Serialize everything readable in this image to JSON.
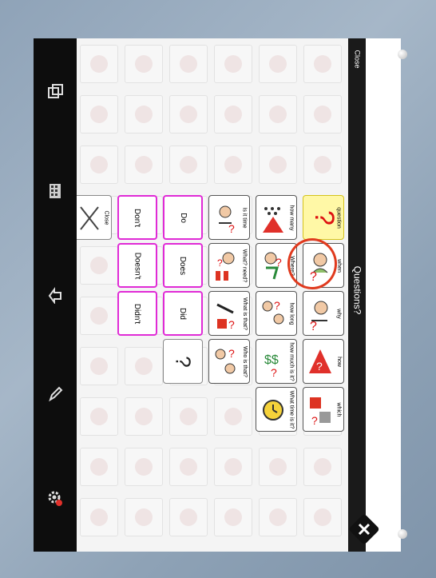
{
  "dialog": {
    "title": "Questions?",
    "close_label": "Close"
  },
  "grid": {
    "col_question": [
      {
        "label": "question",
        "symbol": "big-question-mark"
      },
      {
        "label": "when",
        "symbol": "person-thinking-question"
      },
      {
        "label": "why",
        "symbol": "person-pointing-question"
      },
      {
        "label": "how",
        "symbol": "red-triangle-question"
      },
      {
        "label": "which",
        "symbol": "boxes-question"
      }
    ],
    "col_how": [
      {
        "label": "how many",
        "symbol": "dots-question"
      },
      {
        "label": "Where?",
        "symbol": "person-walking-question"
      },
      {
        "label": "how long",
        "symbol": "people-talking-question"
      },
      {
        "label": "how much is it?",
        "symbol": "money-question"
      },
      {
        "label": "What time is it?",
        "symbol": "clock-question"
      }
    ],
    "col_is": [
      {
        "label": "Is it time",
        "symbol": "person-question"
      },
      {
        "label": "What? need?",
        "symbol": "person-items-question"
      },
      {
        "label": "What is that?",
        "symbol": "person-pointing-object"
      },
      {
        "label": "Who is that?",
        "symbol": "people-question"
      }
    ],
    "col_do": [
      "Do",
      "Does",
      "Did",
      "?"
    ],
    "col_dont": [
      "Don't",
      "Doesn't",
      "Didn't"
    ],
    "close_tile": "Close"
  },
  "toolbar": [
    {
      "name": "copy-icon"
    },
    {
      "name": "keyboard-icon"
    },
    {
      "name": "share-icon"
    },
    {
      "name": "pencil-icon"
    },
    {
      "name": "settings-icon"
    }
  ],
  "colors": {
    "accent_pink": "#e02bd6",
    "highlight_ring": "#e03a1e",
    "question_tile": "#fff8a6"
  }
}
